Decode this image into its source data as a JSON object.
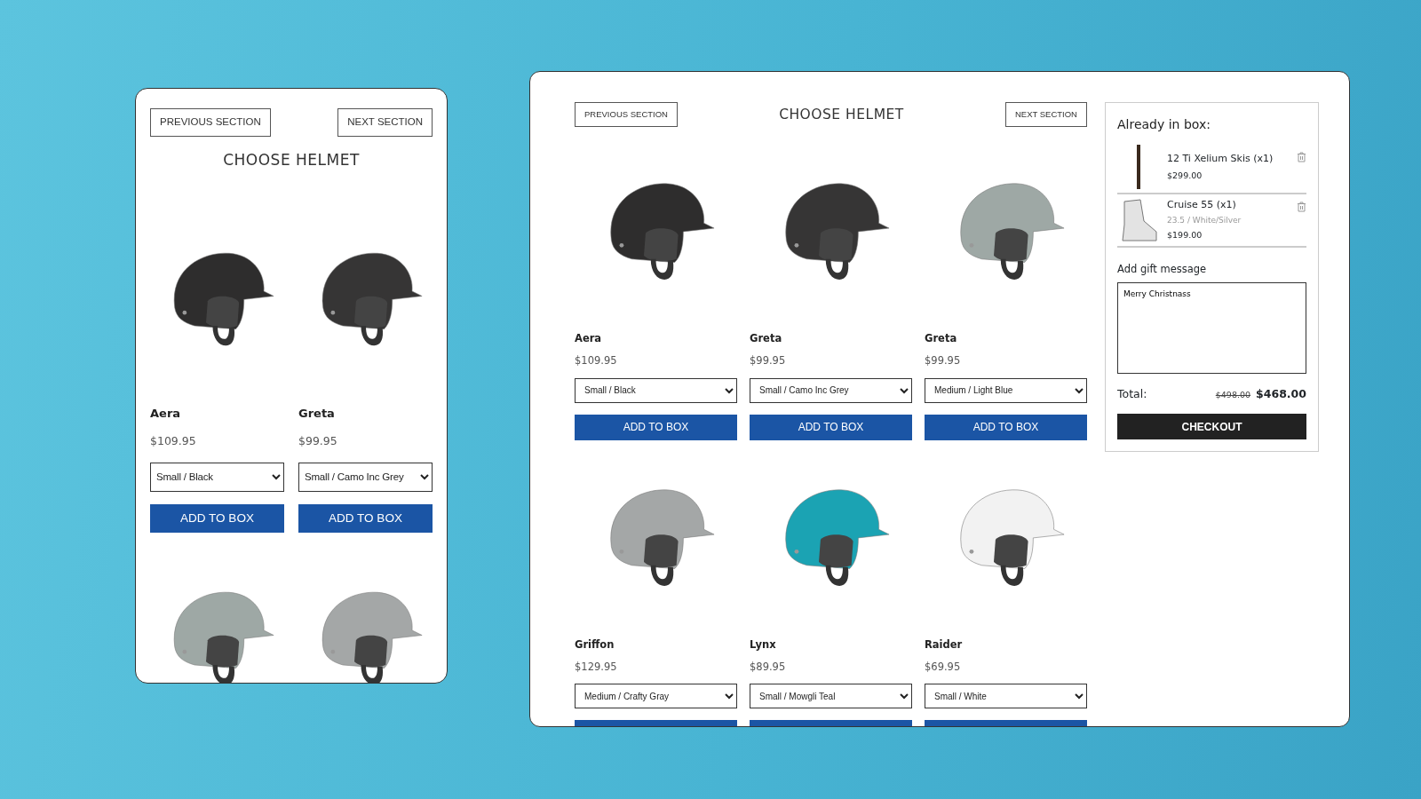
{
  "mobile": {
    "prev_button": "PREVIOUS SECTION",
    "next_button": "NEXT SECTION",
    "title": "CHOOSE HELMET",
    "products": [
      {
        "name": "Aera",
        "price": "$109.95",
        "option": "Small / Black",
        "button": "ADD TO BOX",
        "color": "#2e2d2d"
      },
      {
        "name": "Greta",
        "price": "$99.95",
        "option": "Small / Camo Inc Grey",
        "button": "ADD TO BOX",
        "color": "#363535"
      },
      {
        "color": "#9ea8a5"
      },
      {
        "color": "#a4a7a7"
      }
    ]
  },
  "desktop": {
    "prev_button": "PREVIOUS SECTION",
    "title": "CHOOSE HELMET",
    "next_button": "NEXT SECTION",
    "products": [
      {
        "name": "Aera",
        "price": "$109.95",
        "option": "Small / Black",
        "button": "ADD TO BOX",
        "color": "#2e2d2d"
      },
      {
        "name": "Greta",
        "price": "$99.95",
        "option": "Small / Camo Inc Grey",
        "button": "ADD TO BOX",
        "color": "#363535"
      },
      {
        "name": "Greta",
        "price": "$99.95",
        "option": "Medium / Light Blue",
        "button": "ADD TO BOX",
        "color": "#9ea8a5"
      },
      {
        "name": "Griffon",
        "price": "$129.95",
        "option": "Medium / Crafty Gray",
        "color": "#a4a7a7"
      },
      {
        "name": "Lynx",
        "price": "$89.95",
        "option": "Small / Mowgli Teal",
        "color": "#1ba3b3"
      },
      {
        "name": "Raider",
        "price": "$69.95",
        "option": "Small / White",
        "color": "#f2f2f2"
      }
    ],
    "cart": {
      "title": "Already in box:",
      "items": [
        {
          "kind": "skis",
          "name": "12 Ti Xelium Skis (x1)",
          "price": "$299.00"
        },
        {
          "kind": "boot",
          "name": "Cruise 55 (x1)",
          "variant": "23.5 / White/Silver",
          "price": "$199.00"
        }
      ],
      "gift_label": "Add gift message",
      "gift_message": "Merry Christnass",
      "total_label": "Total:",
      "old_total": "$498.00",
      "total": "$468.00",
      "checkout": "CHECKOUT"
    }
  }
}
